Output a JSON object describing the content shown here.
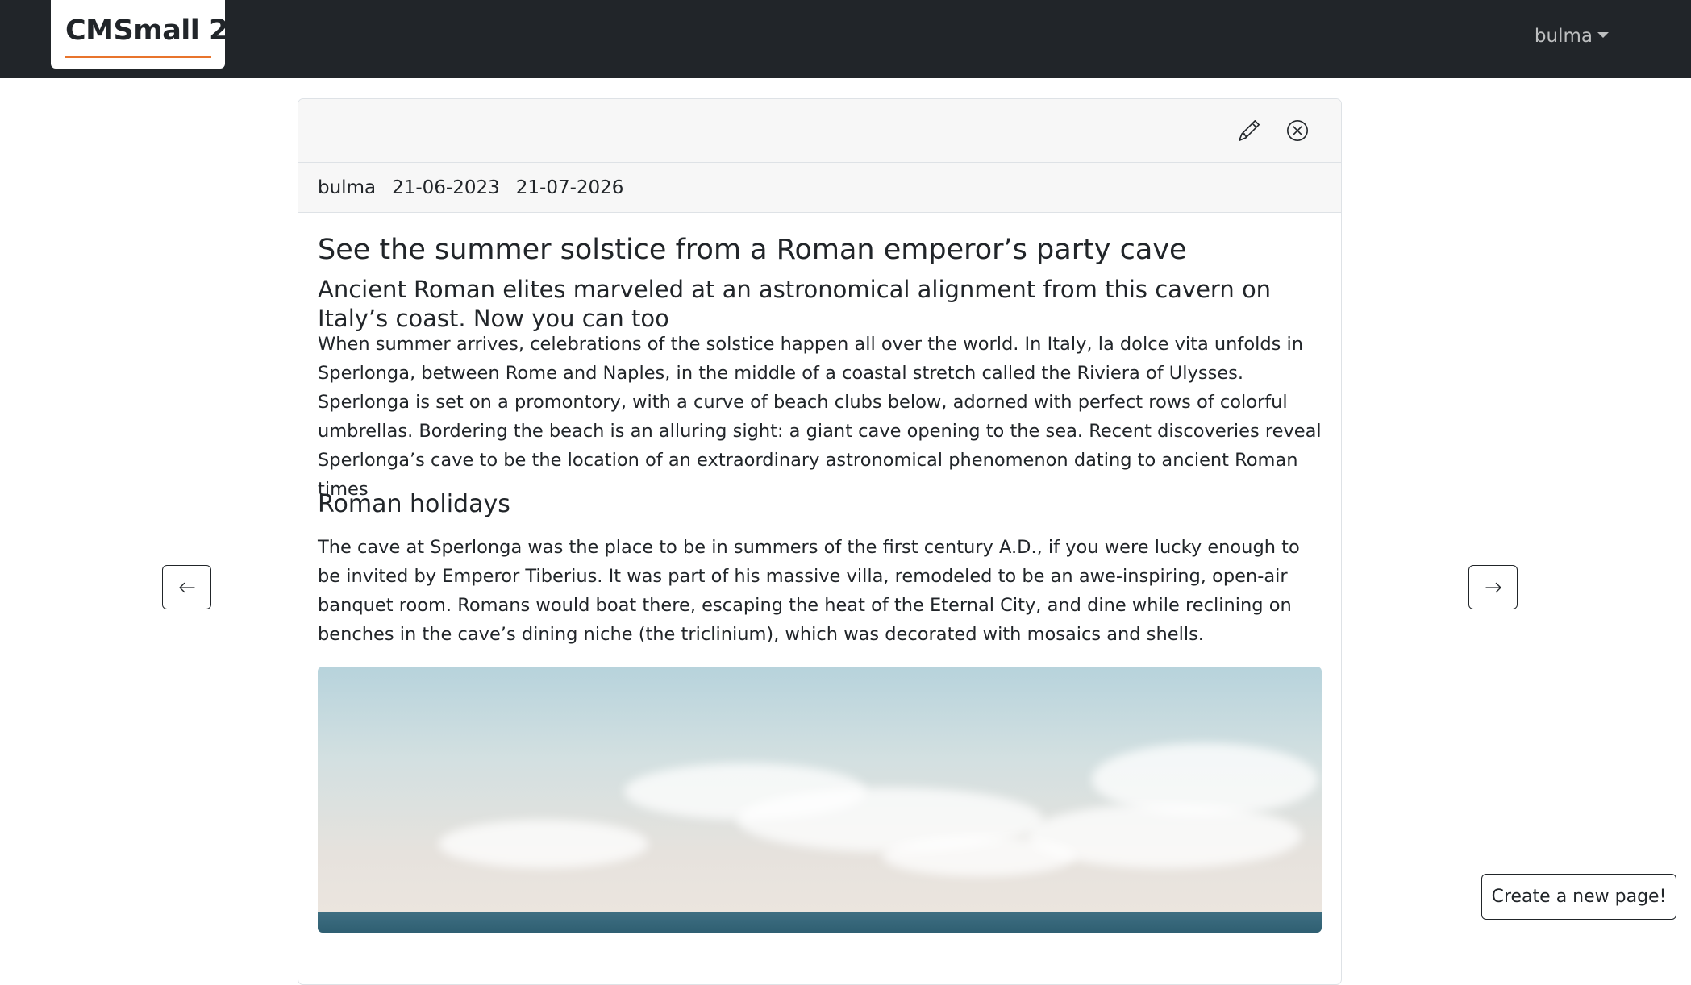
{
  "navbar": {
    "brand": "CMSmall 2",
    "user_menu_label": "bulma"
  },
  "page": {
    "author": "bulma",
    "creation_date": "21-06-2023",
    "publication_date": "21-07-2026",
    "title": "See the summer solstice from a Roman emperor’s party cave",
    "subtitle": "Ancient Roman elites marveled at an astronomical alignment from this cavern on Italy’s coast. Now you can too",
    "paragraph_1": "When summer arrives, celebrations of the solstice happen all over the world. In Italy, la dolce vita unfolds in Sperlonga, between Rome and Naples, in the middle of a coastal stretch called the Riviera of Ulysses. Sperlonga is set on a promontory, with a curve of beach clubs below, adorned with perfect rows of colorful umbrellas. Bordering the beach is an alluring sight: a giant cave opening to the sea. Recent discoveries reveal Sperlonga’s cave to be the location of an extraordinary astronomical phenomenon dating to ancient Roman times",
    "heading_2": "Roman holidays",
    "paragraph_2": "The cave at Sperlonga was the place to be in summers of the first century A.D., if you were lucky enough to be invited by Emperor Tiberius. It was part of his massive villa, remodeled to be an awe-inspiring, open-air banquet room. Romans would boat there, escaping the heat of the Eternal City, and dine while reclining on benches in the cave’s dining niche (the triclinium), which was decorated with mosaics and shells."
  },
  "actions": {
    "edit_icon": "pencil-icon",
    "delete_icon": "x-circle-icon",
    "prev_icon": "arrow-left-icon",
    "next_icon": "arrow-right-icon",
    "create_label": "Create a new page!"
  },
  "colors": {
    "navbar_bg": "#212529",
    "brand_accent": "#e8742c"
  }
}
